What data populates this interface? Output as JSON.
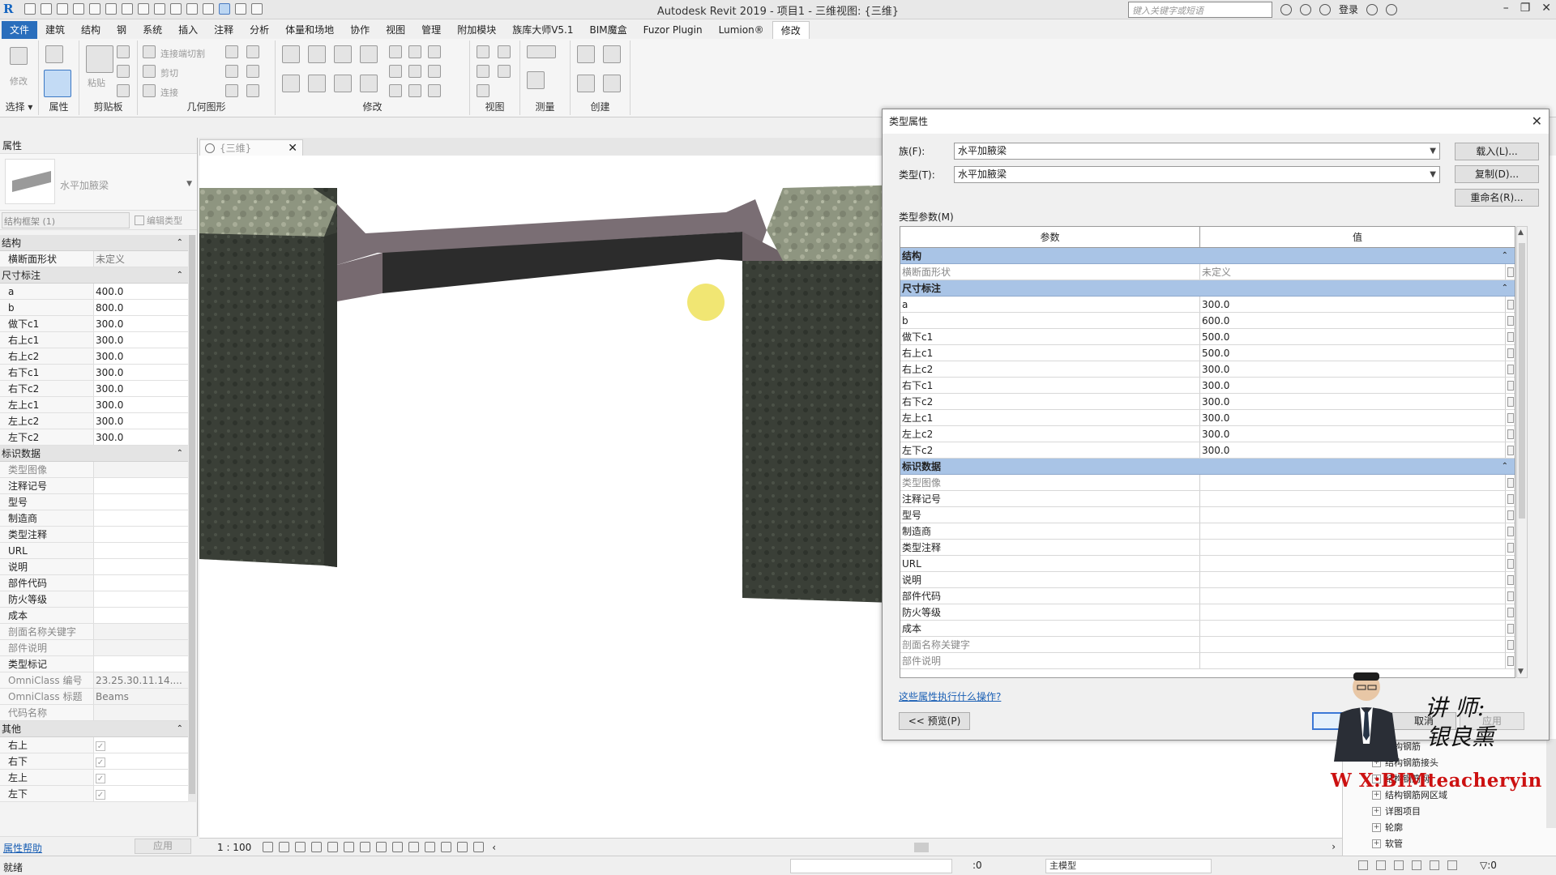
{
  "app": {
    "title": "Autodesk Revit 2019 - 项目1 - 三维视图: {三维}",
    "search_placeholder": "键入关键字或短语",
    "login": "登录"
  },
  "menu": {
    "file": "文件",
    "tabs": [
      "建筑",
      "结构",
      "钢",
      "系统",
      "插入",
      "注释",
      "分析",
      "体量和场地",
      "协作",
      "视图",
      "管理",
      "附加模块",
      "族库大师V5.1",
      "BIM魔盒",
      "Fuzor Plugin",
      "Lumion®"
    ],
    "active": "修改"
  },
  "ribbon": {
    "groups": [
      {
        "label": "选择 ▾"
      },
      {
        "label": "属性"
      },
      {
        "label": "剪贴板"
      },
      {
        "label": "几何图形"
      },
      {
        "label": "修改"
      },
      {
        "label": "视图"
      },
      {
        "label": "测量"
      },
      {
        "label": "创建"
      }
    ],
    "modify_label": "修改",
    "paste_label": "粘贴",
    "cut_join": "连接端切割",
    "cut": "剪切",
    "join": "连接"
  },
  "properties": {
    "title": "属性",
    "type_name": "水平加腋梁",
    "filter": "结构框架 (1)",
    "edit_type": "编辑类型",
    "sections": [
      {
        "name": "结构",
        "rows": [
          {
            "n": "横断面形状",
            "v": "未定义",
            "na": true
          }
        ]
      },
      {
        "name": "尺寸标注",
        "rows": [
          {
            "n": "a",
            "v": "400.0"
          },
          {
            "n": "b",
            "v": "800.0"
          },
          {
            "n": "做下c1",
            "v": "300.0"
          },
          {
            "n": "右上c1",
            "v": "300.0"
          },
          {
            "n": "右上c2",
            "v": "300.0"
          },
          {
            "n": "右下c1",
            "v": "300.0"
          },
          {
            "n": "右下c2",
            "v": "300.0"
          },
          {
            "n": "左上c1",
            "v": "300.0"
          },
          {
            "n": "左上c2",
            "v": "300.0"
          },
          {
            "n": "左下c2",
            "v": "300.0"
          }
        ]
      },
      {
        "name": "标识数据",
        "rows": [
          {
            "n": "类型图像",
            "v": "",
            "dim": true
          },
          {
            "n": "注释记号",
            "v": ""
          },
          {
            "n": "型号",
            "v": ""
          },
          {
            "n": "制造商",
            "v": ""
          },
          {
            "n": "类型注释",
            "v": ""
          },
          {
            "n": "URL",
            "v": ""
          },
          {
            "n": "说明",
            "v": ""
          },
          {
            "n": "部件代码",
            "v": ""
          },
          {
            "n": "防火等级",
            "v": ""
          },
          {
            "n": "成本",
            "v": ""
          },
          {
            "n": "剖面名称关键字",
            "v": "",
            "dim": true
          },
          {
            "n": "部件说明",
            "v": "",
            "dim": true
          },
          {
            "n": "类型标记",
            "v": ""
          },
          {
            "n": "OmniClass 编号",
            "v": "23.25.30.11.14....",
            "dim": true
          },
          {
            "n": "OmniClass 标题",
            "v": "Beams",
            "dim": true
          },
          {
            "n": "代码名称",
            "v": "",
            "dim": true
          }
        ]
      },
      {
        "name": "其他",
        "rows": [
          {
            "n": "右上",
            "v": "✓",
            "chk": true
          },
          {
            "n": "右下",
            "v": "✓",
            "chk": true
          },
          {
            "n": "左上",
            "v": "✓",
            "chk": true
          },
          {
            "n": "左下",
            "v": "✓",
            "chk": true
          }
        ]
      }
    ],
    "help": "属性帮助",
    "apply": "应用"
  },
  "view": {
    "tab": "{三维}",
    "scale": "1 : 100"
  },
  "status": {
    "ready": "就绪",
    "zero": ":0",
    "model": "主模型",
    "filter": "▽:0"
  },
  "browser": {
    "items": [
      "结构钢筋",
      "结构钢筋接头",
      "结构钢筋网",
      "结构钢筋网区域",
      "详图项目",
      "轮廓",
      "软管"
    ]
  },
  "dialog": {
    "title": "类型属性",
    "family_label": "族(F):",
    "family_value": "水平加腋梁",
    "type_label": "类型(T):",
    "type_value": "水平加腋梁",
    "load": "载入(L)...",
    "duplicate": "复制(D)...",
    "rename": "重命名(R)...",
    "type_params": "类型参数(M)",
    "col_param": "参数",
    "col_value": "值",
    "sections": [
      {
        "name": "结构",
        "rows": [
          {
            "n": "横断面形状",
            "v": "未定义",
            "dim": true
          }
        ]
      },
      {
        "name": "尺寸标注",
        "rows": [
          {
            "n": "a",
            "v": "300.0"
          },
          {
            "n": "b",
            "v": "600.0"
          },
          {
            "n": "做下c1",
            "v": "500.0"
          },
          {
            "n": "右上c1",
            "v": "500.0"
          },
          {
            "n": "右上c2",
            "v": "300.0"
          },
          {
            "n": "右下c1",
            "v": "300.0"
          },
          {
            "n": "右下c2",
            "v": "300.0"
          },
          {
            "n": "左上c1",
            "v": "300.0"
          },
          {
            "n": "左上c2",
            "v": "300.0"
          },
          {
            "n": "左下c2",
            "v": "300.0"
          }
        ]
      },
      {
        "name": "标识数据",
        "rows": [
          {
            "n": "类型图像",
            "v": "",
            "dim": true
          },
          {
            "n": "注释记号",
            "v": ""
          },
          {
            "n": "型号",
            "v": ""
          },
          {
            "n": "制造商",
            "v": ""
          },
          {
            "n": "类型注释",
            "v": ""
          },
          {
            "n": "URL",
            "v": ""
          },
          {
            "n": "说明",
            "v": ""
          },
          {
            "n": "部件代码",
            "v": ""
          },
          {
            "n": "防火等级",
            "v": ""
          },
          {
            "n": "成本",
            "v": ""
          },
          {
            "n": "剖面名称关键字",
            "v": "",
            "dim": true
          },
          {
            "n": "部件说明",
            "v": "",
            "dim": true
          }
        ]
      }
    ],
    "help_link": "这些属性执行什么操作?",
    "preview": "<< 预览(P)",
    "cancel": "取消",
    "apply": "应用"
  },
  "overlay": {
    "lecturer": "讲 师:",
    "lecturer_name": "银良熏",
    "wechat": "W X:BIMteacheryin"
  }
}
